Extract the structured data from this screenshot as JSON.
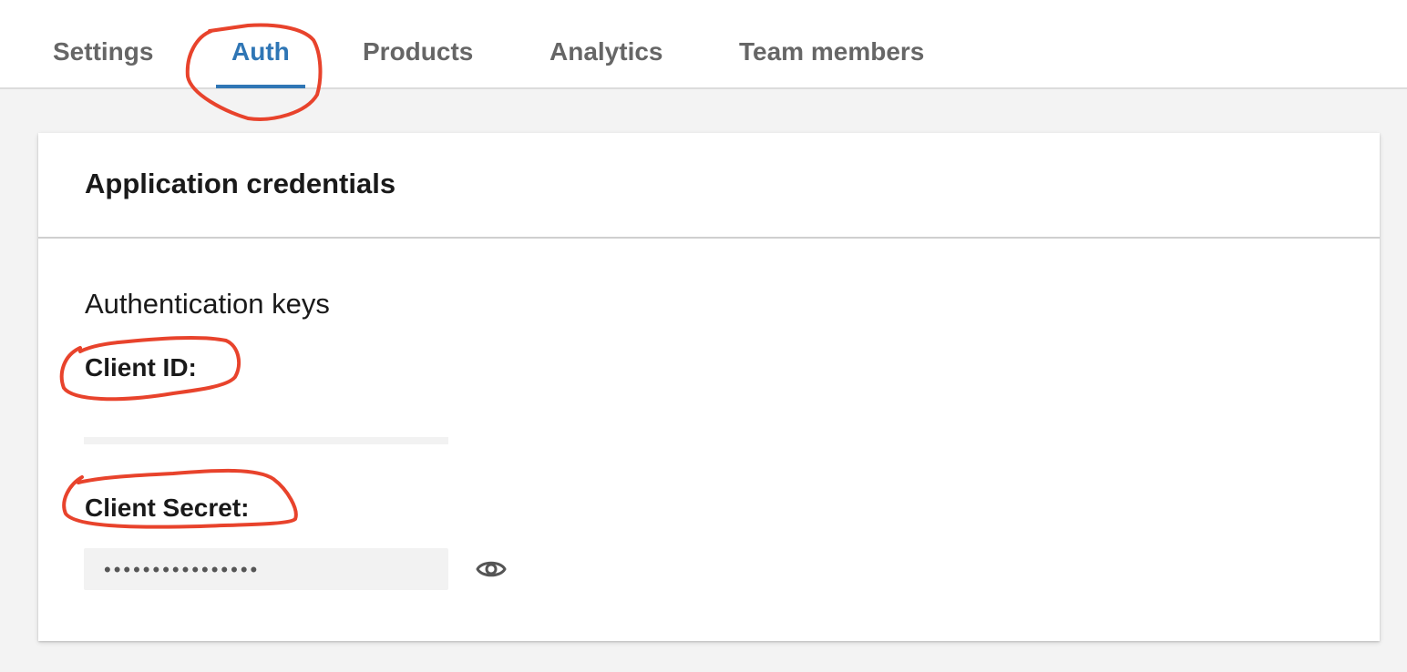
{
  "tabs": [
    {
      "label": "Settings",
      "active": false
    },
    {
      "label": "Auth",
      "active": true
    },
    {
      "label": "Products",
      "active": false
    },
    {
      "label": "Analytics",
      "active": false
    },
    {
      "label": "Team members",
      "active": false
    }
  ],
  "card": {
    "title": "Application credentials",
    "section_title": "Authentication keys",
    "client_id": {
      "label": "Client ID:",
      "value": ""
    },
    "client_secret": {
      "label": "Client Secret:",
      "masked_value": "••••••••••••••••",
      "reveal_icon": "eye-icon"
    }
  },
  "colors": {
    "accent": "#2f76b5",
    "annotation": "#e8432c",
    "tab_inactive": "#666666",
    "page_background": "#f3f3f3"
  }
}
